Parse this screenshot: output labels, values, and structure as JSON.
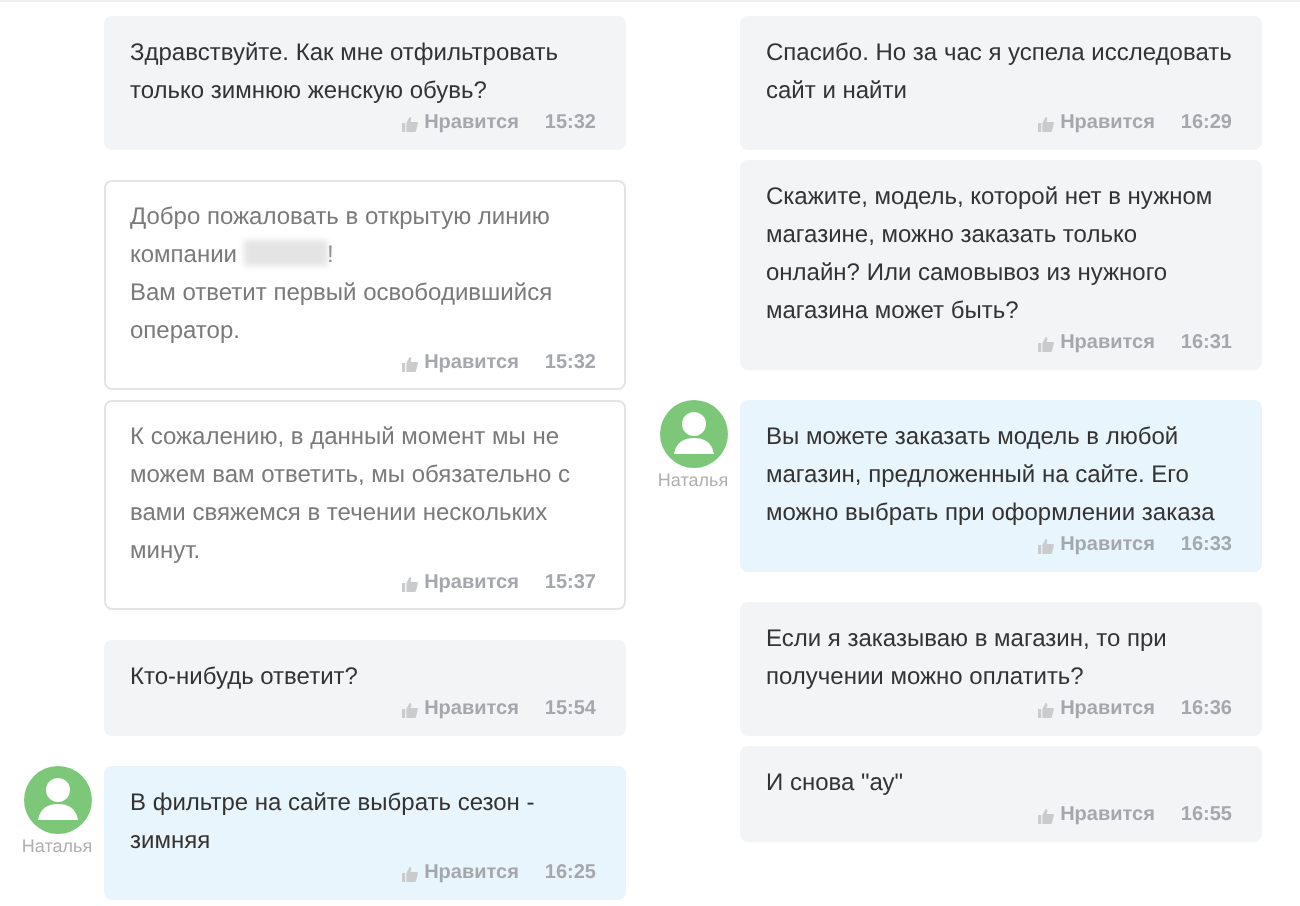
{
  "columns": [
    {
      "messages": [
        {
          "kind": "client",
          "text": "Здравствуйте. Как мне отфильтровать только зимнюю женскую обувь?",
          "like": "Нравится",
          "time": "15:32"
        },
        {
          "kind": "system",
          "text": "Добро пожаловать в открытую линию компании",
          "redacted": true,
          "text_after": "!\nВам ответит первый освободившийся оператор.",
          "like": "Нравится",
          "time": "15:32"
        },
        {
          "kind": "system",
          "text": "К сожалению, в данный момент мы не можем вам ответить, мы обязательно с вами свяжемся в течении нескольких минут.",
          "like": "Нравится",
          "time": "15:37"
        },
        {
          "kind": "client",
          "text": "Кто-нибудь ответит?",
          "like": "Нравится",
          "time": "15:54"
        },
        {
          "kind": "operator",
          "author": "Наталья",
          "text": "В фильтре на сайте выбрать сезон - зимняя",
          "like": "Нравится",
          "time": "16:25"
        }
      ]
    },
    {
      "messages": [
        {
          "kind": "client",
          "text": "Спасибо. Но за час я успела исследовать сайт и найти",
          "like": "Нравится",
          "time": "16:29"
        },
        {
          "kind": "client",
          "text": "Скажите, модель, которой нет в нужном магазине, можно заказать только онлайн? Или самовывоз из нужного магазина может быть?",
          "like": "Нравится",
          "time": "16:31"
        },
        {
          "kind": "operator",
          "author": "Наталья",
          "text": "Вы можете заказать модель в любой магазин, предложенный на сайте. Его можно выбрать при оформлении заказа",
          "like": "Нравится",
          "time": "16:33"
        },
        {
          "kind": "client",
          "text": "Если я заказываю в магазин, то при получении можно оплатить?",
          "like": "Нравится",
          "time": "16:36"
        },
        {
          "kind": "client",
          "text": "И снова \"ау\"",
          "like": "Нравится",
          "time": "16:55"
        }
      ]
    }
  ]
}
